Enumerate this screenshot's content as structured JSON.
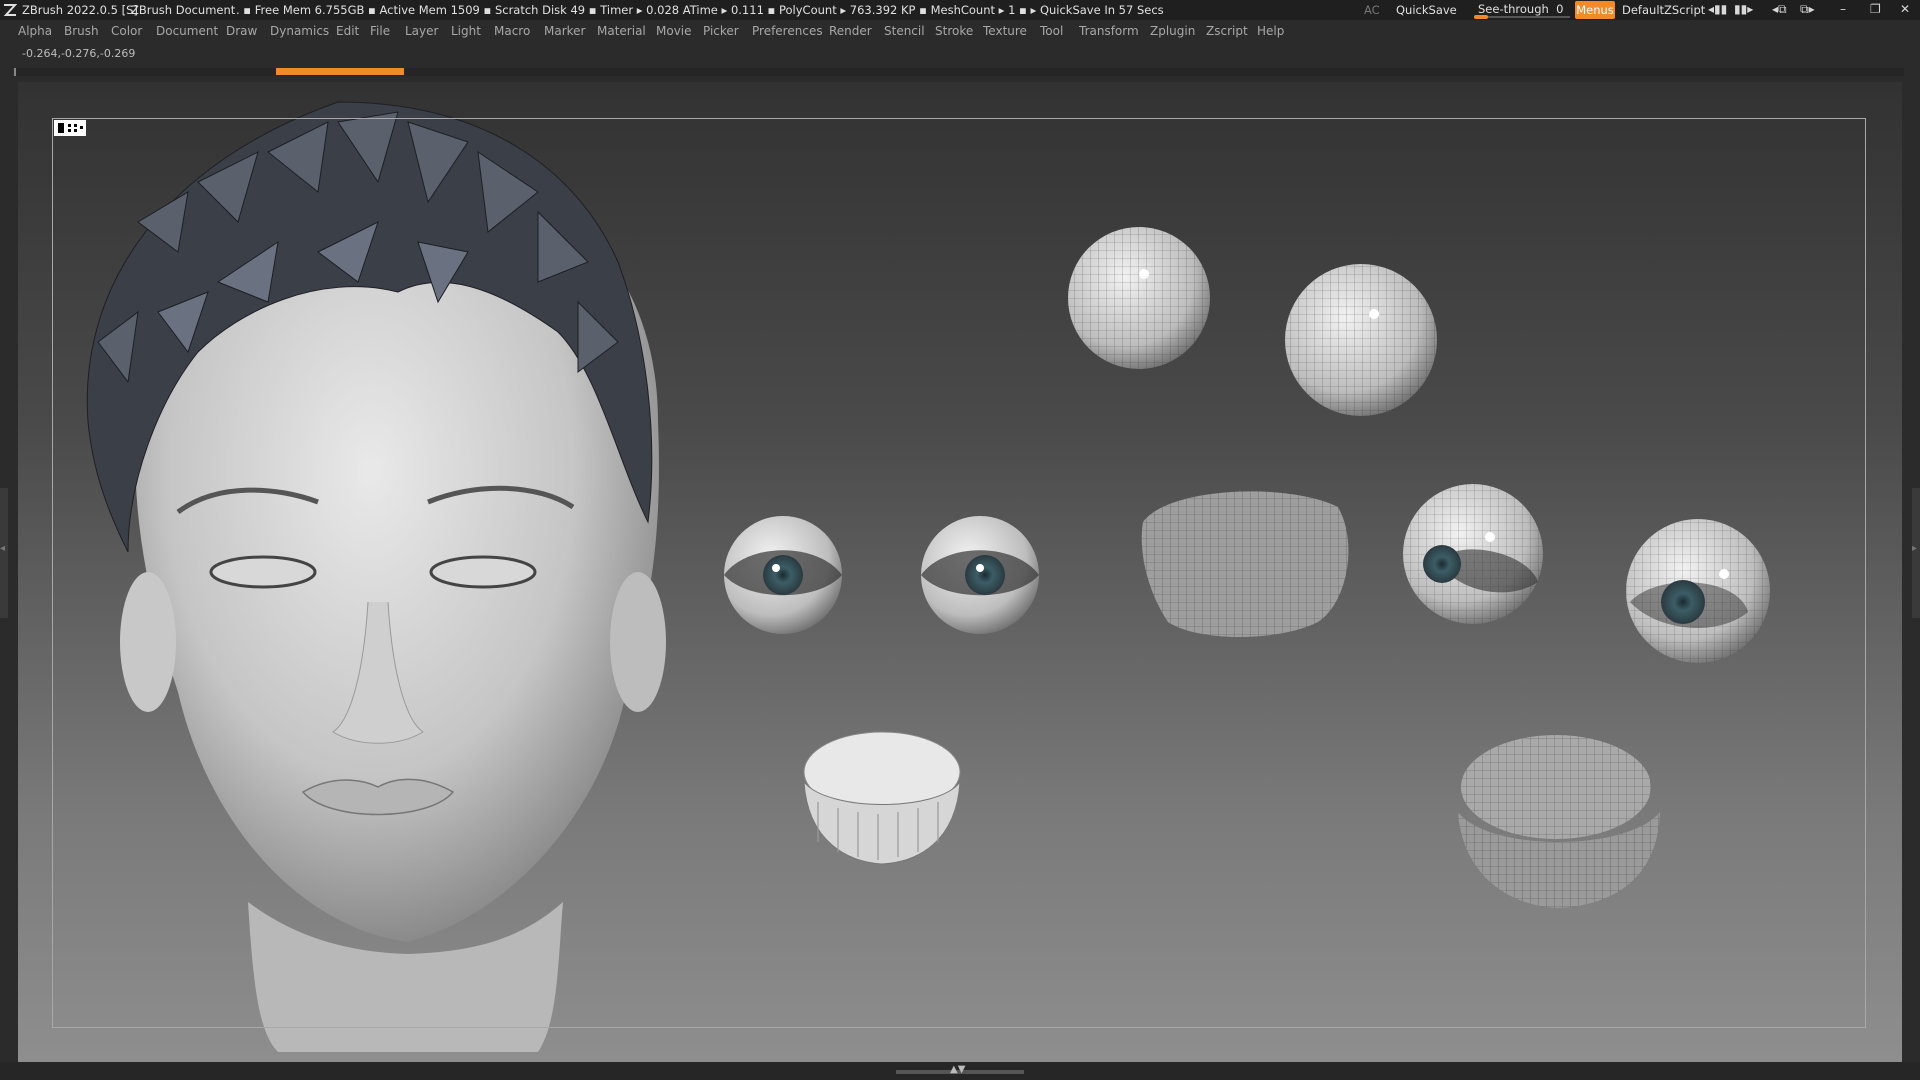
{
  "titlebar": {
    "app": "ZBrush 2022.0.5 [S]",
    "document": "ZBrush Document",
    "stats": ". ▪ Free Mem 6.755GB ▪ Active Mem 1509 ▪ Scratch Disk 49 ▪ Timer ▸ 0.028 ATime ▸ 0.111 ▪ PolyCount ▸ 763.392 KP ▪ MeshCount ▸ 1 ▪ ▸ QuickSave In 57 Secs",
    "ac": "AC",
    "quicksave": "QuickSave",
    "see_through_label": "See-through",
    "see_through_value": "0",
    "see_through_level": 0,
    "menus": "Menus",
    "script": "DefaultZScript"
  },
  "menubar": [
    "Alpha",
    "Brush",
    "Color",
    "Document",
    "Draw",
    "Dynamics",
    "Edit",
    "File",
    "Layer",
    "Light",
    "Macro",
    "Marker",
    "Material",
    "Movie",
    "Picker",
    "Preferences",
    "Render",
    "Stencil",
    "Stroke",
    "Texture",
    "Tool",
    "Transform",
    "Zplugin",
    "Zscript",
    "Help"
  ],
  "coords": "-0.264,-0.276,-0.269",
  "colors": {
    "accent": "#f08b28",
    "titlebar_bg": "#1f1f1f",
    "menubar_bg": "#2b2b2b",
    "canvas_top": "#323232",
    "canvas_bottom": "#8e8e8e"
  },
  "icons": {
    "logo": "zbrush-logo-icon",
    "window_controls": [
      "minimize-icon",
      "restore-icon",
      "close-icon"
    ]
  }
}
